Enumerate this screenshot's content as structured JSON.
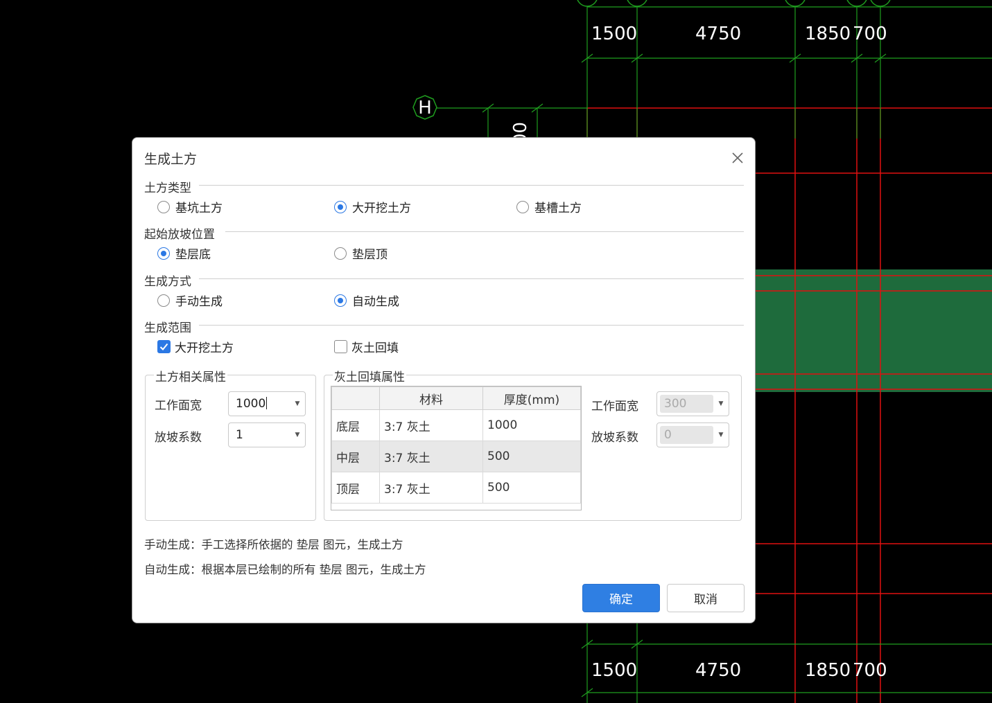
{
  "canvas": {
    "colors": {
      "background": "#000000",
      "grid_green": "#1f9e1f",
      "grid_red": "#e01010",
      "fill_green": "#1e6b3c",
      "dim_text": "#ffffff"
    },
    "axis_labels": {
      "h_axis": "H",
      "partial_dim": "00"
    },
    "top_dims": [
      "1500",
      "4750",
      "1850",
      "700"
    ],
    "bottom_dims": [
      "1500",
      "4750",
      "1850",
      "700"
    ]
  },
  "dialog": {
    "title": "生成土方",
    "sections": {
      "type": {
        "title": "土方类型",
        "options": [
          {
            "label": "基坑土方",
            "selected": false
          },
          {
            "label": "大开挖土方",
            "selected": true
          },
          {
            "label": "基槽土方",
            "selected": false
          }
        ]
      },
      "slope_start": {
        "title": "起始放坡位置",
        "options": [
          {
            "label": "垫层底",
            "selected": true
          },
          {
            "label": "垫层顶",
            "selected": false
          }
        ]
      },
      "method": {
        "title": "生成方式",
        "options": [
          {
            "label": "手动生成",
            "selected": false
          },
          {
            "label": "自动生成",
            "selected": true
          }
        ]
      },
      "scope": {
        "title": "生成范围",
        "options": [
          {
            "label": "大开挖土方",
            "checked": true
          },
          {
            "label": "灰土回填",
            "checked": false
          }
        ]
      }
    },
    "earth_props": {
      "title": "土方相关属性",
      "work_width_label": "工作面宽",
      "work_width_value": "1000",
      "slope_label": "放坡系数",
      "slope_value": "1"
    },
    "fill_props": {
      "title": "灰土回填属性",
      "columns": [
        "",
        "材料",
        "厚度(mm)"
      ],
      "rows": [
        {
          "layer": "底层",
          "material": "3:7 灰土",
          "thickness": "1000"
        },
        {
          "layer": "中层",
          "material": "3:7 灰土",
          "thickness": "500"
        },
        {
          "layer": "顶层",
          "material": "3:7 灰土",
          "thickness": "500"
        }
      ],
      "work_width_label": "工作面宽",
      "work_width_value": "300",
      "slope_label": "放坡系数",
      "slope_value": "0"
    },
    "notes": [
      "手动生成：手工选择所依据的 垫层 图元，生成土方",
      "自动生成：根据本层已绘制的所有 垫层 图元，生成土方"
    ],
    "buttons": {
      "ok": "确定",
      "cancel": "取消"
    }
  }
}
